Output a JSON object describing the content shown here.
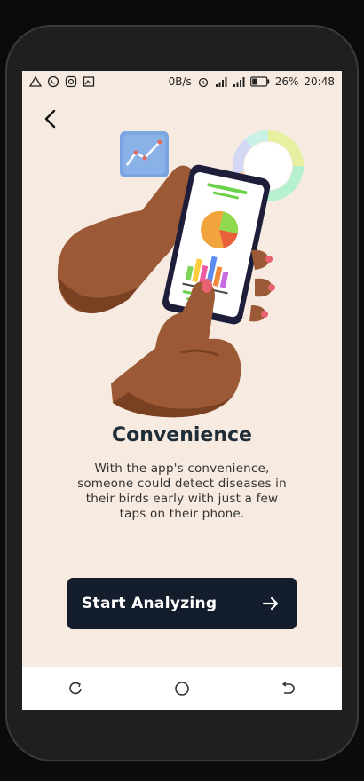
{
  "status_bar": {
    "net_speed": "0B/s",
    "battery": "26%",
    "time": "20:48",
    "icons_left": [
      "alert-icon",
      "whatsapp-icon",
      "instagram-icon",
      "gallery-icon"
    ],
    "icons_right": [
      "alarm-icon",
      "signal-icon",
      "4g-signal-icon",
      "battery-icon"
    ]
  },
  "onboarding": {
    "title": "Convenience",
    "description": "With the app's convenience, someone could detect diseases in their birds early with just a few taps on their phone.",
    "cta_label": "Start Analyzing"
  },
  "colors": {
    "background": "#f7ebe1",
    "button": "#131d2b",
    "title": "#1f2d38",
    "skin": "#9b5a35",
    "skin_dark": "#7a4022"
  },
  "navbar": {
    "buttons": [
      "recent-apps-icon",
      "home-icon",
      "back-nav-icon"
    ]
  }
}
